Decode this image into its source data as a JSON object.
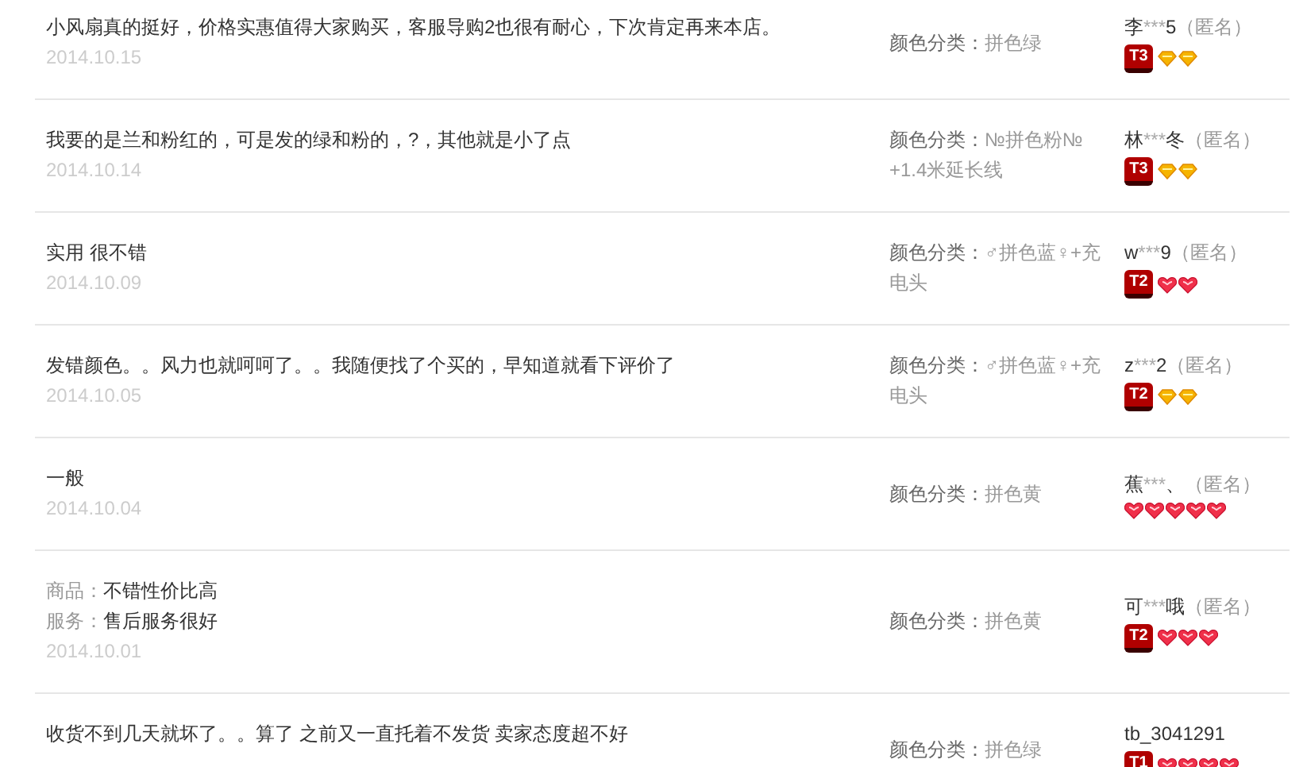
{
  "reviews": [
    {
      "kind": "plain",
      "comment": "小风扇真的挺好，价格实惠值得大家购买，客服导购2也很有耐心，下次肯定再来本店。",
      "date": "2014.10.15",
      "sku_label": "颜色分类：",
      "sku_value": "拼色绿",
      "user": {
        "start": "李",
        "mask": "***",
        "end": "5",
        "tag": "（匿名）"
      },
      "level": "T3",
      "gems": [
        {
          "kind": "diamond"
        },
        {
          "kind": "diamond"
        }
      ]
    },
    {
      "kind": "plain",
      "comment": "我要的是兰和粉红的，可是发的绿和粉的，?，其他就是小了点",
      "date": "2014.10.14",
      "sku_label": "颜色分类：",
      "sku_value": "№拼色粉№+1.4米延长线",
      "user": {
        "start": "林",
        "mask": "***",
        "end": "冬",
        "tag": "（匿名）"
      },
      "level": "T3",
      "gems": [
        {
          "kind": "diamond"
        },
        {
          "kind": "diamond"
        }
      ]
    },
    {
      "kind": "plain",
      "comment": "实用 很不错",
      "date": "2014.10.09",
      "sku_label": "颜色分类：",
      "sku_value": "♂拼色蓝♀+充电头",
      "user": {
        "start": "w",
        "mask": "***",
        "end": "9",
        "tag": "（匿名）"
      },
      "level": "T2",
      "gems": [
        {
          "kind": "heart"
        },
        {
          "kind": "heart"
        }
      ]
    },
    {
      "kind": "plain",
      "comment": "发错颜色。。风力也就呵呵了。。我随便找了个买的，早知道就看下评价了",
      "date": "2014.10.05",
      "sku_label": "颜色分类：",
      "sku_value": "♂拼色蓝♀+充电头",
      "user": {
        "start": "z",
        "mask": "***",
        "end": "2",
        "tag": "（匿名）"
      },
      "level": "T2",
      "gems": [
        {
          "kind": "diamond"
        },
        {
          "kind": "diamond"
        }
      ]
    },
    {
      "kind": "plain",
      "comment": "一般",
      "date": "2014.10.04",
      "sku_label": "颜色分类：",
      "sku_value": "拼色黄",
      "user": {
        "start": "蕉",
        "mask": "***",
        "end": "、",
        "tag": "（匿名）"
      },
      "gems": [
        {
          "kind": "heart"
        },
        {
          "kind": "heart"
        },
        {
          "kind": "heart"
        },
        {
          "kind": "heart"
        },
        {
          "kind": "heart"
        }
      ]
    },
    {
      "kind": "parts",
      "parts": [
        {
          "label": "商品：",
          "text": "不错性价比高"
        },
        {
          "label": "服务：",
          "text": "售后服务很好"
        }
      ],
      "date": "2014.10.01",
      "sku_label": "颜色分类：",
      "sku_value": "拼色黄",
      "user": {
        "start": "可",
        "mask": "***",
        "end": "哦",
        "tag": "（匿名）"
      },
      "level": "T2",
      "gems": [
        {
          "kind": "heart"
        },
        {
          "kind": "heart"
        },
        {
          "kind": "heart"
        }
      ]
    },
    {
      "kind": "plain",
      "comment": "收货不到几天就坏了。。算了 之前又一直托着不发货 卖家态度超不好",
      "sku_label": "颜色分类：",
      "sku_value": "拼色绿",
      "user": {
        "start": "tb_3041291"
      },
      "level": "T1",
      "gems": [
        {
          "kind": "heart"
        },
        {
          "kind": "heart"
        },
        {
          "kind": "heart"
        },
        {
          "kind": "heart"
        }
      ]
    }
  ]
}
